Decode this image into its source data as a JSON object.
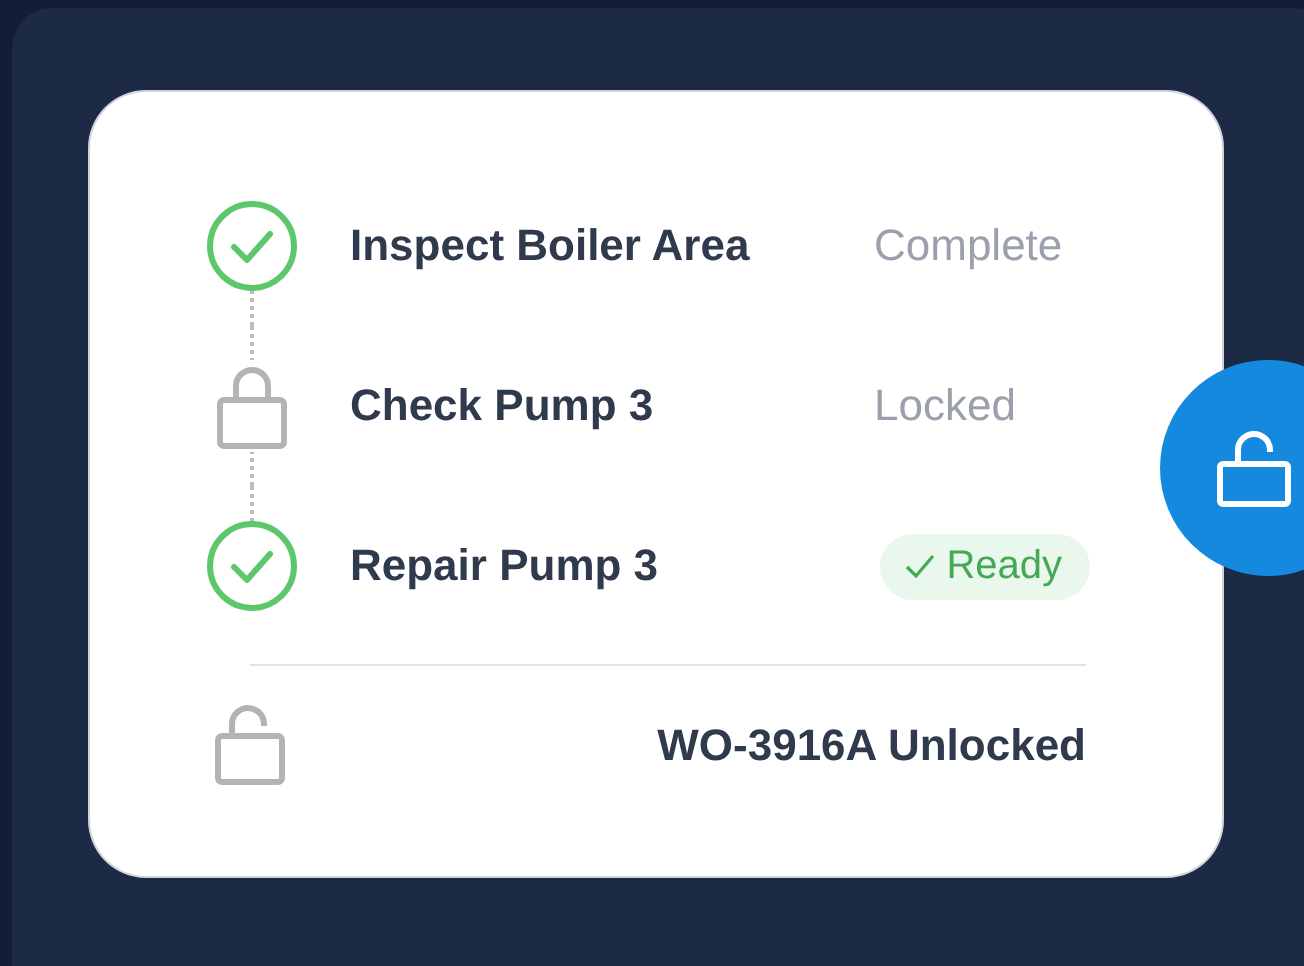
{
  "steps": [
    {
      "title": "Inspect Boiler Area",
      "status": "Complete",
      "checked": true,
      "highlighted": false
    },
    {
      "title": "Check Pump 3",
      "status": "Locked",
      "checked": false,
      "highlighted": false
    },
    {
      "title": "Repair Pump 3",
      "status": "Ready",
      "checked": true,
      "highlighted": true
    }
  ],
  "footer": {
    "text": "WO-3916A Unlocked",
    "locked": false
  },
  "fab": {
    "locked": false
  }
}
